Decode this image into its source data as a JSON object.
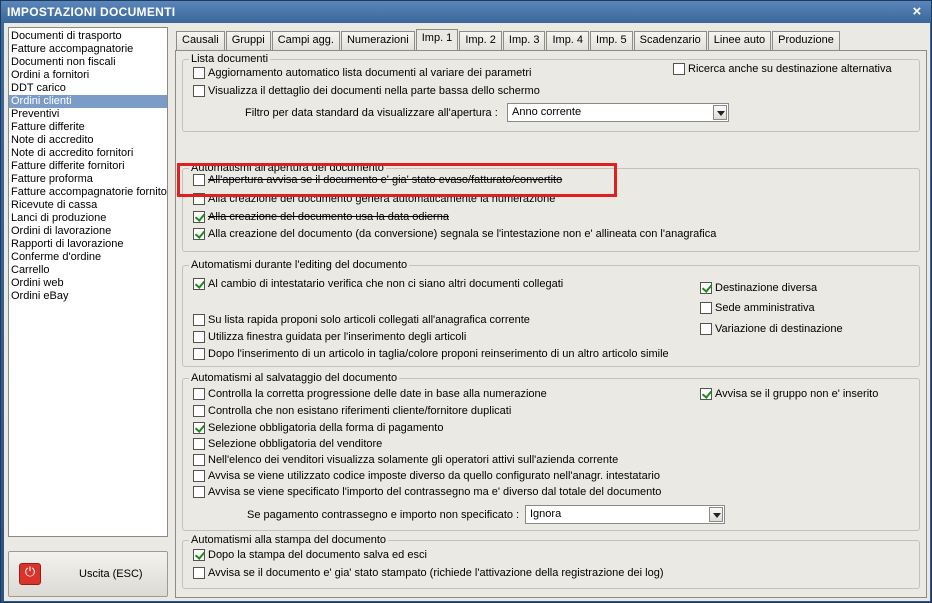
{
  "window": {
    "title": "IMPOSTAZIONI DOCUMENTI",
    "close": "×"
  },
  "doclist": {
    "items": [
      "Documenti di trasporto",
      "Fatture accompagnatorie",
      "Documenti non fiscali",
      "Ordini a fornitori",
      "DDT carico",
      "Ordini clienti",
      "Preventivi",
      "Fatture differite",
      "Note di accredito",
      "Note di accredito fornitori",
      "Fatture differite fornitori",
      "Fatture proforma",
      "Fatture accompagnatorie fornito",
      "Ricevute di cassa",
      "Lanci di produzione",
      "Ordini di lavorazione",
      "Rapporti di lavorazione",
      "Conferme d'ordine",
      "Carrello",
      "Ordini web",
      "Ordini eBay"
    ],
    "selected": "Ordini clienti"
  },
  "exit_button": {
    "label": "Uscita (ESC)",
    "icon": "power-icon"
  },
  "tabs": [
    "Causali",
    "Gruppi",
    "Campi agg.",
    "Numerazioni",
    "Imp. 1",
    "Imp. 2",
    "Imp. 3",
    "Imp. 4",
    "Imp. 5",
    "Scadenzario",
    "Linee auto",
    "Produzione"
  ],
  "active_tab": "Imp. 1",
  "lista": {
    "title": "Lista documenti",
    "opt1": "Aggiornamento automatico lista documenti al variare dei parametri",
    "opt2": "Visualizza il dettaglio dei documenti nella parte bassa dello schermo",
    "opt3": "Ricerca anche su destinazione alternativa",
    "filter_label": "Filtro per data standard da visualizzare all'apertura :",
    "filter_value": "Anno corrente"
  },
  "apertura": {
    "title": "Automatismi all'apertura del documento",
    "opt1": "All'apertura avvisa se il documento e' gia' stato evaso/fatturato/convertito",
    "opt2": "Alla creazione del documento genera automaticamente la numerazione",
    "opt3": "Alla creazione del documento usa la data odierna",
    "opt4": "Alla creazione del documento (da conversione) segnala se l'intestazione non e' allineata con l'anagrafica"
  },
  "editing": {
    "title": "Automatismi durante l'editing del documento",
    "opt1": "Al cambio di intestatario verifica che non ci siano altri documenti collegati",
    "opt2": "Su lista rapida proponi solo articoli collegati all'anagrafica corrente",
    "opt3": "Utilizza finestra guidata per l'inserimento degli articoli",
    "opt4": "Dopo l'inserimento di un articolo in taglia/colore proponi reinserimento di un altro articolo simile",
    "opt5": "Destinazione diversa",
    "opt6": "Sede amministrativa",
    "opt7": "Variazione di destinazione"
  },
  "salvataggio": {
    "title": "Automatismi al salvataggio del documento",
    "opt1": "Controlla la corretta progressione delle date in base alla numerazione",
    "opt2": "Controlla che non esistano riferimenti cliente/fornitore duplicati",
    "opt3": "Selezione obbligatoria della forma di pagamento",
    "opt4": "Selezione obbligatoria del venditore",
    "opt5": "Nell'elenco dei venditori visualizza solamente gli operatori attivi sull'azienda corrente",
    "opt6": "Avvisa se viene utilizzato codice imposte diverso da quello configurato nell'anagr. intestatario",
    "opt7": "Avvisa se viene specificato l'importo del contrassegno ma e' diverso dal totale del documento",
    "opt8": "Avvisa se il gruppo non e' inserito",
    "pay_label": "Se pagamento contrassegno e importo non specificato :",
    "pay_value": "Ignora"
  },
  "stampa": {
    "title": "Automatismi alla stampa del documento",
    "opt1": "Dopo la stampa del documento salva ed esci",
    "opt2": "Avvisa se il documento e' gia' stato stampato (richiede l'attivazione della registrazione dei log)"
  },
  "colors": {
    "highlight": "#e02020",
    "selection": "#7c9cc8",
    "titlebar": "#3a6799"
  }
}
